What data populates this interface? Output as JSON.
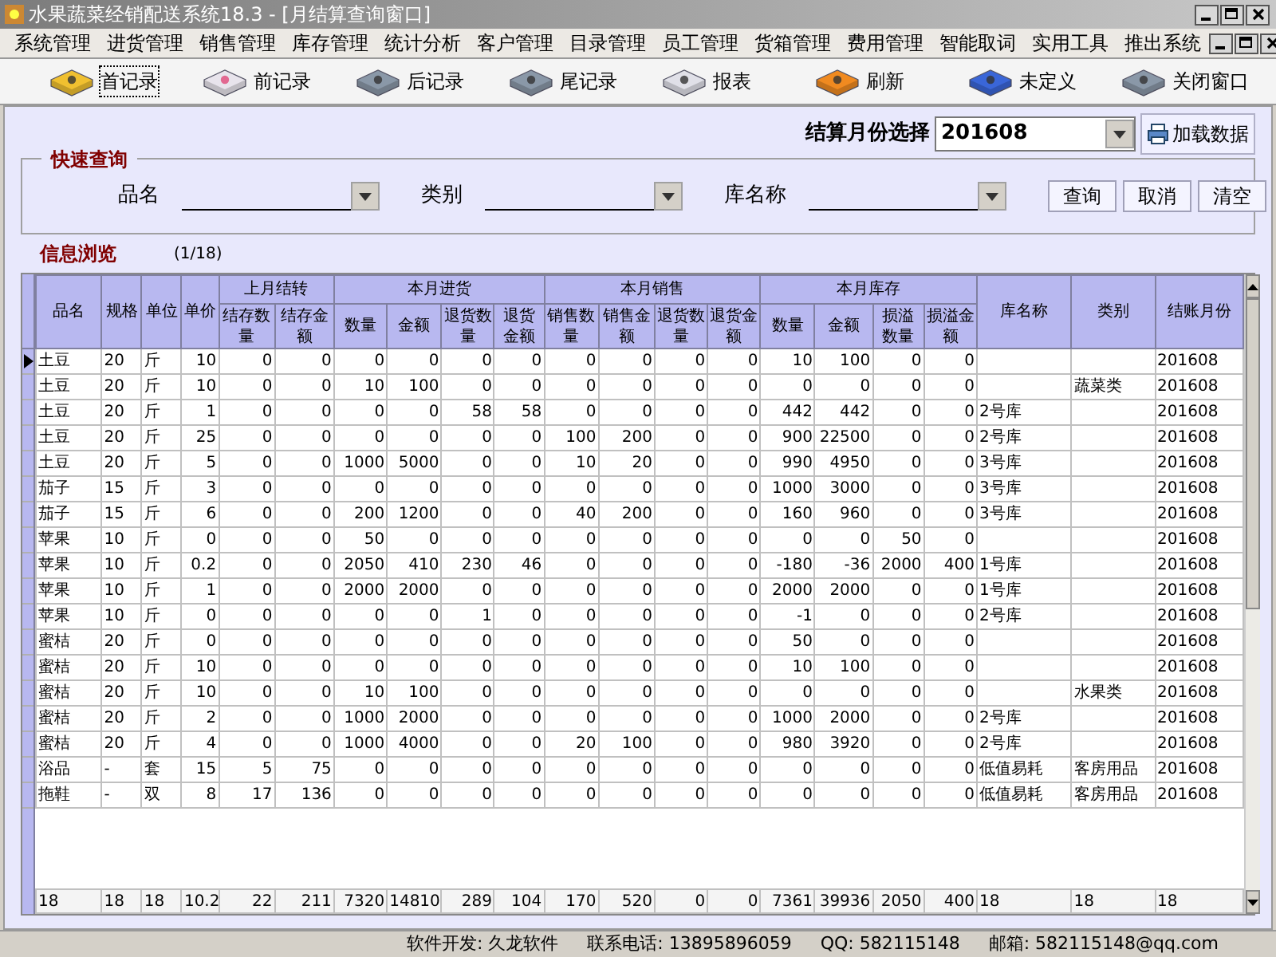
{
  "window": {
    "title": "水果蔬菜经销配送系统18.3 - [月结算查询窗口]"
  },
  "menu": [
    "系统管理",
    "进货管理",
    "销售管理",
    "库存管理",
    "统计分析",
    "客户管理",
    "目录管理",
    "员工管理",
    "货箱管理",
    "费用管理",
    "智能取词",
    "实用工具",
    "推出系统"
  ],
  "toolbar": [
    {
      "label": "首记录",
      "selected": true
    },
    {
      "label": "前记录",
      "selected": false
    },
    {
      "label": "后记录",
      "selected": false
    },
    {
      "label": "尾记录",
      "selected": false
    },
    {
      "label": "报表",
      "selected": false
    },
    {
      "label": "刷新",
      "selected": false
    },
    {
      "label": "未定义",
      "selected": false
    },
    {
      "label": "关闭窗口",
      "selected": false
    }
  ],
  "settlement": {
    "label": "结算月份选择",
    "value": "201608",
    "button": "加载数据"
  },
  "quick_query": {
    "title": "快速查询",
    "fields": [
      {
        "label": "品名"
      },
      {
        "label": "类别"
      },
      {
        "label": "库名称"
      }
    ],
    "buttons": [
      "查询",
      "取消",
      "清空"
    ]
  },
  "info": {
    "title": "信息浏览",
    "count": "(1/18)"
  },
  "table": {
    "header_rows": [
      [
        {
          "label": "品名",
          "kind": "text",
          "rowspan": 2
        },
        {
          "label": "规格",
          "kind": "text",
          "rowspan": 2
        },
        {
          "label": "单位",
          "kind": "text",
          "rowspan": 2
        },
        {
          "label": "单价",
          "kind": "number",
          "rowspan": 2
        },
        {
          "label": "上月结转",
          "colspan": 2
        },
        {
          "label": "本月进货",
          "colspan": 4
        },
        {
          "label": "本月销售",
          "colspan": 4
        },
        {
          "label": "本月库存",
          "colspan": 4
        },
        {
          "label": "库名称",
          "kind": "text",
          "rowspan": 2
        },
        {
          "label": "类别",
          "kind": "text",
          "rowspan": 2
        },
        {
          "label": "结账月份",
          "kind": "text",
          "rowspan": 2
        }
      ],
      [
        {
          "label": "结存数量",
          "kind": "number"
        },
        {
          "label": "结存金额",
          "kind": "number"
        },
        {
          "label": "数量",
          "kind": "number"
        },
        {
          "label": "金额",
          "kind": "number"
        },
        {
          "label": "退货数量",
          "kind": "number"
        },
        {
          "label": "退货金额",
          "kind": "number"
        },
        {
          "label": "销售数量",
          "kind": "number"
        },
        {
          "label": "销售金额",
          "kind": "number"
        },
        {
          "label": "退货数量",
          "kind": "number"
        },
        {
          "label": "退货金额",
          "kind": "number"
        },
        {
          "label": "数量",
          "kind": "number"
        },
        {
          "label": "金额",
          "kind": "number"
        },
        {
          "label": "损溢数量",
          "kind": "number"
        },
        {
          "label": "损溢金额",
          "kind": "number"
        }
      ]
    ],
    "rows": [
      {
        "current": true,
        "cells": [
          "土豆",
          "20",
          "斤",
          "10",
          "0",
          "0",
          "0",
          "0",
          "0",
          "0",
          "0",
          "0",
          "0",
          "0",
          "10",
          "100",
          "0",
          "0",
          "",
          "",
          "201608"
        ]
      },
      {
        "current": false,
        "cells": [
          "土豆",
          "20",
          "斤",
          "10",
          "0",
          "0",
          "10",
          "100",
          "0",
          "0",
          "0",
          "0",
          "0",
          "0",
          "0",
          "0",
          "0",
          "0",
          "",
          "蔬菜类",
          "201608"
        ]
      },
      {
        "current": false,
        "cells": [
          "土豆",
          "20",
          "斤",
          "1",
          "0",
          "0",
          "0",
          "0",
          "58",
          "58",
          "0",
          "0",
          "0",
          "0",
          "442",
          "442",
          "0",
          "0",
          "2号库",
          "",
          "201608"
        ]
      },
      {
        "current": false,
        "cells": [
          "土豆",
          "20",
          "斤",
          "25",
          "0",
          "0",
          "0",
          "0",
          "0",
          "0",
          "100",
          "200",
          "0",
          "0",
          "900",
          "22500",
          "0",
          "0",
          "2号库",
          "",
          "201608"
        ]
      },
      {
        "current": false,
        "cells": [
          "土豆",
          "20",
          "斤",
          "5",
          "0",
          "0",
          "1000",
          "5000",
          "0",
          "0",
          "10",
          "20",
          "0",
          "0",
          "990",
          "4950",
          "0",
          "0",
          "3号库",
          "",
          "201608"
        ]
      },
      {
        "current": false,
        "cells": [
          "茄子",
          "15",
          "斤",
          "3",
          "0",
          "0",
          "0",
          "0",
          "0",
          "0",
          "0",
          "0",
          "0",
          "0",
          "1000",
          "3000",
          "0",
          "0",
          "3号库",
          "",
          "201608"
        ]
      },
      {
        "current": false,
        "cells": [
          "茄子",
          "15",
          "斤",
          "6",
          "0",
          "0",
          "200",
          "1200",
          "0",
          "0",
          "40",
          "200",
          "0",
          "0",
          "160",
          "960",
          "0",
          "0",
          "3号库",
          "",
          "201608"
        ]
      },
      {
        "current": false,
        "cells": [
          "苹果",
          "10",
          "斤",
          "0",
          "0",
          "0",
          "50",
          "0",
          "0",
          "0",
          "0",
          "0",
          "0",
          "0",
          "0",
          "0",
          "50",
          "0",
          "",
          "",
          "201608"
        ]
      },
      {
        "current": false,
        "cells": [
          "苹果",
          "10",
          "斤",
          "0.2",
          "0",
          "0",
          "2050",
          "410",
          "230",
          "46",
          "0",
          "0",
          "0",
          "0",
          "-180",
          "-36",
          "2000",
          "400",
          "1号库",
          "",
          "201608"
        ]
      },
      {
        "current": false,
        "cells": [
          "苹果",
          "10",
          "斤",
          "1",
          "0",
          "0",
          "2000",
          "2000",
          "0",
          "0",
          "0",
          "0",
          "0",
          "0",
          "2000",
          "2000",
          "0",
          "0",
          "1号库",
          "",
          "201608"
        ]
      },
      {
        "current": false,
        "cells": [
          "苹果",
          "10",
          "斤",
          "0",
          "0",
          "0",
          "0",
          "0",
          "1",
          "0",
          "0",
          "0",
          "0",
          "0",
          "-1",
          "0",
          "0",
          "0",
          "2号库",
          "",
          "201608"
        ]
      },
      {
        "current": false,
        "cells": [
          "蜜桔",
          "20",
          "斤",
          "0",
          "0",
          "0",
          "0",
          "0",
          "0",
          "0",
          "0",
          "0",
          "0",
          "0",
          "50",
          "0",
          "0",
          "0",
          "",
          "",
          "201608"
        ]
      },
      {
        "current": false,
        "cells": [
          "蜜桔",
          "20",
          "斤",
          "10",
          "0",
          "0",
          "0",
          "0",
          "0",
          "0",
          "0",
          "0",
          "0",
          "0",
          "10",
          "100",
          "0",
          "0",
          "",
          "",
          "201608"
        ]
      },
      {
        "current": false,
        "cells": [
          "蜜桔",
          "20",
          "斤",
          "10",
          "0",
          "0",
          "10",
          "100",
          "0",
          "0",
          "0",
          "0",
          "0",
          "0",
          "0",
          "0",
          "0",
          "0",
          "",
          "水果类",
          "201608"
        ]
      },
      {
        "current": false,
        "cells": [
          "蜜桔",
          "20",
          "斤",
          "2",
          "0",
          "0",
          "1000",
          "2000",
          "0",
          "0",
          "0",
          "0",
          "0",
          "0",
          "1000",
          "2000",
          "0",
          "0",
          "2号库",
          "",
          "201608"
        ]
      },
      {
        "current": false,
        "cells": [
          "蜜桔",
          "20",
          "斤",
          "4",
          "0",
          "0",
          "1000",
          "4000",
          "0",
          "0",
          "20",
          "100",
          "0",
          "0",
          "980",
          "3920",
          "0",
          "0",
          "2号库",
          "",
          "201608"
        ]
      },
      {
        "current": false,
        "cells": [
          "浴品",
          "-",
          "套",
          "15",
          "5",
          "75",
          "0",
          "0",
          "0",
          "0",
          "0",
          "0",
          "0",
          "0",
          "0",
          "0",
          "0",
          "0",
          "低值易耗",
          "客房用品",
          "201608"
        ]
      },
      {
        "current": false,
        "cells": [
          "拖鞋",
          "-",
          "双",
          "8",
          "17",
          "136",
          "0",
          "0",
          "0",
          "0",
          "0",
          "0",
          "0",
          "0",
          "0",
          "0",
          "0",
          "0",
          "低值易耗",
          "客房用品",
          "201608"
        ]
      }
    ],
    "totals": [
      "18",
      "18",
      "18",
      "10.2",
      "22",
      "211",
      "7320",
      "14810",
      "289",
      "104",
      "170",
      "520",
      "0",
      "0",
      "7361",
      "39936",
      "2050",
      "400",
      "18",
      "18",
      "18"
    ]
  },
  "status_bar": [
    "软件开发: 久龙软件",
    "联系电话: 13895896059",
    "QQ: 582115148",
    "邮箱: 582115148@qq.com"
  ]
}
